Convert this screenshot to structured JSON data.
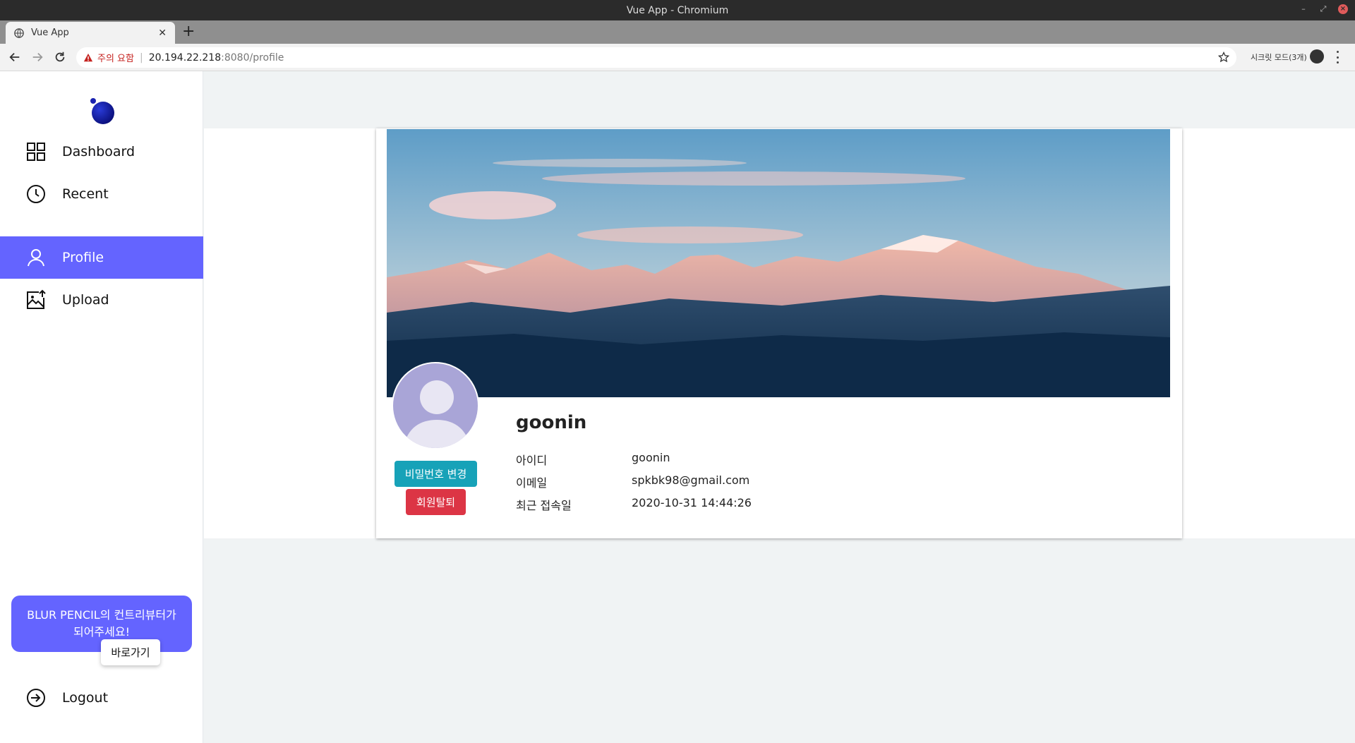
{
  "window": {
    "title": "Vue App - Chromium"
  },
  "tab": {
    "title": "Vue App"
  },
  "address": {
    "warning": "주의 요함",
    "host": "20.194.22.218",
    "rest": ":8080/profile"
  },
  "incognito": {
    "label": "시크릿 모드(3개)"
  },
  "sidebar": {
    "items": [
      {
        "label": "Dashboard",
        "icon": "dashboard-grid-icon"
      },
      {
        "label": "Recent",
        "icon": "clock-icon"
      },
      {
        "label": "Profile",
        "icon": "user-icon",
        "active": true
      },
      {
        "label": "Upload",
        "icon": "image-upload-icon"
      }
    ],
    "promo": {
      "text": "BLUR PENCIL의 컨트리뷰터가 되어주세요!",
      "button": "바로가기"
    },
    "logout": "Logout"
  },
  "profile": {
    "username": "goonin",
    "buttons": {
      "change_password": "비밀번호 변경",
      "withdraw": "회원탈퇴"
    },
    "fields": [
      {
        "label": "아이디",
        "value": "goonin"
      },
      {
        "label": "이메일",
        "value": "spkbk98@gmail.com"
      },
      {
        "label": "최근 접속일",
        "value": "2020-10-31 14:44:26"
      }
    ]
  },
  "colors": {
    "accent": "#6464ff",
    "info_button": "#17a2b8",
    "danger_button": "#dc3545",
    "avatar_bg": "#a9a5d7"
  }
}
